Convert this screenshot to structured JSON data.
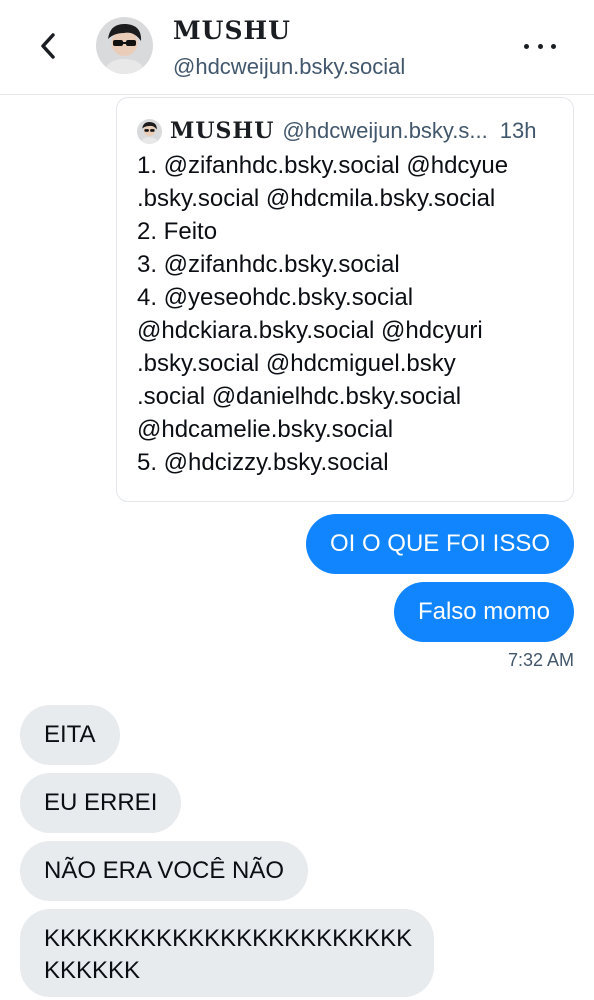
{
  "header": {
    "name": "MUSHU",
    "handle": "@hdcweijun.bsky.social"
  },
  "quote": {
    "name": "MUSHU",
    "handle": "@hdcweijun.bsky.s...",
    "time": "13h",
    "lines": [
      "1. @zifanhdc.bsky.social @hdcyue",
      ".bsky.social @hdcmila.bsky.social",
      "2. Feito",
      "3. @zifanhdc.bsky.social",
      "4. @yeseohdc.bsky.social",
      "@hdckiara.bsky.social @hdcyuri",
      ".bsky.social @hdcmiguel.bsky",
      ".social @danielhdc.bsky.social",
      "@hdcamelie.bsky.social",
      "5. @hdcizzy.bsky.social"
    ]
  },
  "messages": {
    "sent": [
      "OI O QUE FOI ISSO",
      "Falso momo"
    ],
    "sent_time": "7:32 AM",
    "received": [
      "EITA",
      "EU ERREI",
      "NÃO ERA VOCÊ NÃO",
      "KKKKKKKKKKKKKKKKKKKKKKK",
      "KKKKKK"
    ]
  },
  "colors": {
    "accent": "#1185fe",
    "received_bubble": "#e8ebee",
    "secondary_text": "#42576c"
  },
  "icons": {
    "back": "chevron-left-icon",
    "more": "more-horizontal-icon"
  }
}
